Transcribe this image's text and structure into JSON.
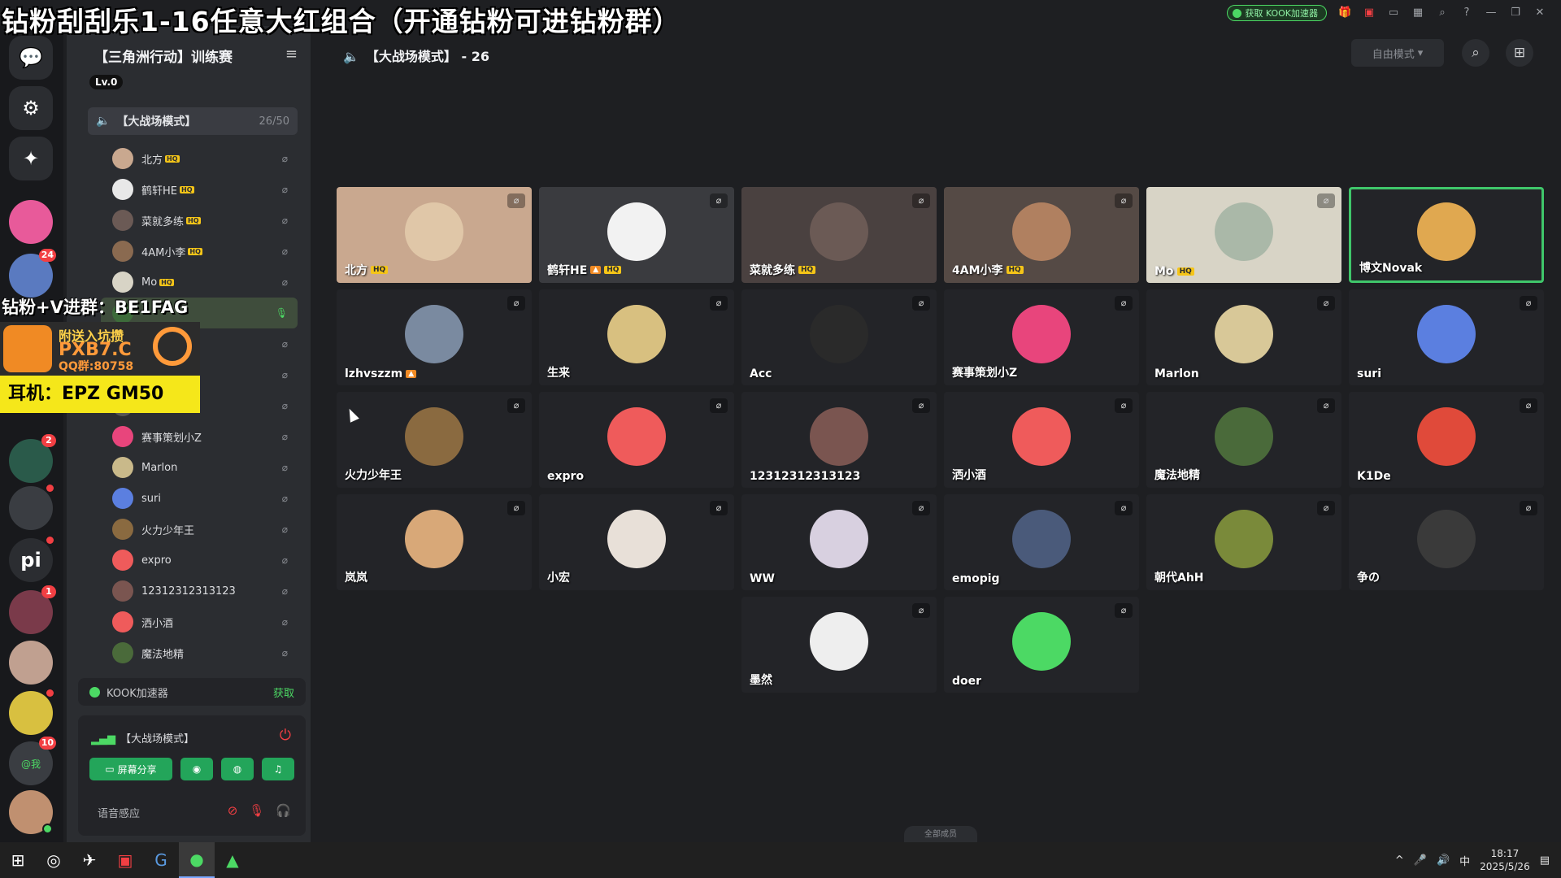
{
  "banner": "钻粉刮刮乐1-16任意大红组合（开通钻粉可进钻粉群）",
  "topbar": {
    "accel_btn": "获取 KOOK加速器",
    "icons": [
      "gift-icon",
      "shop-icon",
      "folder-icon",
      "window-icon",
      "search-icon",
      "help-icon",
      "minimize-icon",
      "restore-icon",
      "close-icon"
    ]
  },
  "rail": {
    "badges": {
      "server_5": "24",
      "server_8": "2",
      "server_12": "1",
      "server_15": "10"
    },
    "at_me": "@我"
  },
  "sidebar": {
    "server_name": "【三角洲行动】训练赛",
    "level": "Lv.0",
    "channel": {
      "name": "【大战场模式】",
      "count": "26/50"
    },
    "members": [
      {
        "name": "北方",
        "hq": true,
        "color": "#c9a88f"
      },
      {
        "name": "鹤轩HE",
        "hq": true,
        "color": "#e8e8e8"
      },
      {
        "name": "菜就多练",
        "hq": true,
        "color": "#6b5a55"
      },
      {
        "name": "4AM小李",
        "hq": true,
        "color": "#8a6a50"
      },
      {
        "name": "Mo",
        "hq": true,
        "color": "#d8d4c6"
      },
      {
        "name": "",
        "hq": false,
        "color": "#3d6b3a",
        "active": true
      },
      {
        "name": "",
        "hq": false,
        "color": "#555"
      },
      {
        "name": "",
        "hq": false,
        "color": "#555"
      },
      {
        "name": "",
        "hq": false,
        "color": "#555"
      },
      {
        "name": "赛事策划小Z",
        "hq": false,
        "color": "#e8457c"
      },
      {
        "name": "Marlon",
        "hq": false,
        "color": "#c9b98a"
      },
      {
        "name": "suri",
        "hq": false,
        "color": "#5b7fe0"
      },
      {
        "name": "火力少年王",
        "hq": false,
        "color": "#8a6a40"
      },
      {
        "name": "expro",
        "hq": false,
        "color": "#ef5b5b"
      },
      {
        "name": "12312312313123",
        "hq": false,
        "color": "#7a5550"
      },
      {
        "name": "洒小酒",
        "hq": false,
        "color": "#ef5b5b"
      },
      {
        "name": "魔法地精",
        "hq": false,
        "color": "#4a6a3a"
      }
    ],
    "accel": {
      "label": "KOOK加速器",
      "action": "获取"
    },
    "voice": {
      "channel": "【大战场模式】",
      "screen_share": "屏幕分享",
      "voice_sense": "语音感应"
    }
  },
  "ad": {
    "line1": "钻粉+V进群：BE1FAG",
    "t1": "附送入坑攒",
    "t2": "PXB7.C",
    "t3": "QQ群:80758",
    "bar": "耳机：EPZ GM50"
  },
  "main": {
    "title": "【大战场模式】 - 26",
    "mode": "自由模式",
    "all_members": "全部成员",
    "tiles": [
      {
        "name": "北方",
        "hq": true,
        "bg": "#c9a88f",
        "av": "#e0c7a8"
      },
      {
        "name": "鹤轩HE",
        "hq": true,
        "lvl": true,
        "bg": "#3a3b3f",
        "av": "#f2f2f2"
      },
      {
        "name": "菜就多练",
        "hq": true,
        "bg": "#4a4140",
        "av": "#6b5a55"
      },
      {
        "name": "4AM小李",
        "hq": true,
        "bg": "#554a45",
        "av": "#b08060"
      },
      {
        "name": "Mo",
        "hq": true,
        "bg": "#d8d4c6",
        "av": "#aab8a8"
      },
      {
        "name": "博文Novak",
        "speaking": true,
        "bg": "#232428",
        "av": "#e0a850"
      },
      {
        "name": "lzhvszzm",
        "lvl": true,
        "av": "#7a8aa0"
      },
      {
        "name": "生来",
        "av": "#d8c080"
      },
      {
        "name": "Acc",
        "av": "#2a2a2a"
      },
      {
        "name": "赛事策划小Z",
        "av": "#e8457c"
      },
      {
        "name": "Marlon",
        "av": "#d8c898"
      },
      {
        "name": "suri",
        "av": "#5b7fe0"
      },
      {
        "name": "火力少年王",
        "av": "#8a6a40"
      },
      {
        "name": "expro",
        "av": "#ef5b5b"
      },
      {
        "name": "12312312313123",
        "av": "#7a5550"
      },
      {
        "name": "洒小酒",
        "av": "#ef5b5b"
      },
      {
        "name": "魔法地精",
        "av": "#4a6a3a"
      },
      {
        "name": "K1De",
        "av": "#e04a3a"
      },
      {
        "name": "岚岚",
        "av": "#d8a878"
      },
      {
        "name": "小宏",
        "av": "#e8e0d8"
      },
      {
        "name": "WW",
        "av": "#d8d0e0"
      },
      {
        "name": "emopig",
        "av": "#4a5a7a"
      },
      {
        "name": "朝代AhH",
        "av": "#7a8a3a"
      },
      {
        "name": "争の",
        "av": "#3a3a3a"
      },
      {
        "name": "墨然",
        "av": "#eeeeee"
      },
      {
        "name": "doer",
        "av": "#4cd964"
      }
    ]
  },
  "taskbar": {
    "clock_time": "18:17",
    "clock_date": "2025/5/26",
    "ime": "中"
  }
}
